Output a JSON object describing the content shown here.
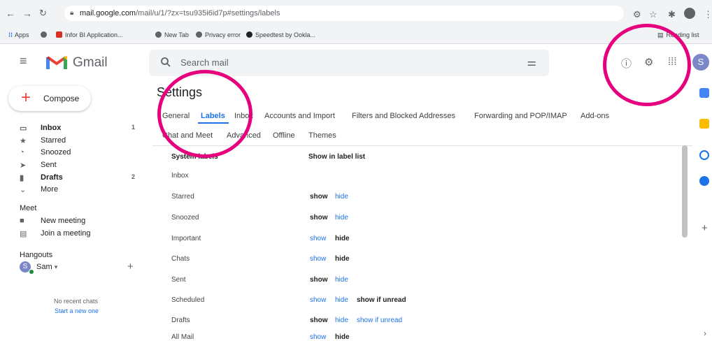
{
  "browser": {
    "url_host": "mail.google.com",
    "url_path": "/mail/u/1/?zx=tsu935i6id7p#settings/labels",
    "bookmarks": [
      "Apps",
      "Infor BI Application...",
      "New Tab",
      "Privacy error",
      "Speedtest by Ookla..."
    ],
    "reading_list": "Reading list"
  },
  "header": {
    "app_name": "Gmail",
    "search_placeholder": "Search mail",
    "avatar_letter": "S"
  },
  "sidebar": {
    "compose": "Compose",
    "items": [
      {
        "label": "Inbox",
        "count": "1",
        "icon": "inbox-icon"
      },
      {
        "label": "Starred",
        "count": "",
        "icon": "star-icon"
      },
      {
        "label": "Snoozed",
        "count": "",
        "icon": "clock-icon"
      },
      {
        "label": "Sent",
        "count": "",
        "icon": "send-icon"
      },
      {
        "label": "Drafts",
        "count": "2",
        "icon": "draft-icon"
      },
      {
        "label": "More",
        "count": "",
        "icon": "chevron-down-icon"
      }
    ],
    "meet_title": "Meet",
    "meet_items": [
      "New meeting",
      "Join a meeting"
    ],
    "hangouts_title": "Hangouts",
    "hangouts_user": "Sam",
    "hangouts_user_letter": "S",
    "no_recent": "No recent chats",
    "start_new": "Start a new one"
  },
  "settings": {
    "title": "Settings",
    "tabs_row1": [
      "General",
      "Labels",
      "Inbox",
      "Accounts and Import",
      "Filters and Blocked Addresses",
      "Forwarding and POP/IMAP",
      "Add-ons"
    ],
    "tabs_row2": [
      "Chat and Meet",
      "Advanced",
      "Offline",
      "Themes"
    ],
    "col_system": "System labels",
    "col_show": "Show in label list",
    "labels": [
      {
        "name": "Inbox",
        "opts": []
      },
      {
        "name": "Starred",
        "opts": [
          "show",
          "hide"
        ],
        "selected": "show"
      },
      {
        "name": "Snoozed",
        "opts": [
          "show",
          "hide"
        ],
        "selected": "show"
      },
      {
        "name": "Important",
        "opts": [
          "show",
          "hide"
        ],
        "selected": "hide"
      },
      {
        "name": "Chats",
        "opts": [
          "show",
          "hide"
        ],
        "selected": "hide"
      },
      {
        "name": "Sent",
        "opts": [
          "show",
          "hide"
        ],
        "selected": "show"
      },
      {
        "name": "Scheduled",
        "opts": [
          "show",
          "hide",
          "show if unread"
        ],
        "selected": "show if unread"
      },
      {
        "name": "Drafts",
        "opts": [
          "show",
          "hide",
          "show if unread"
        ],
        "selected": "show"
      },
      {
        "name": "All Mail",
        "opts": [
          "show",
          "hide"
        ],
        "selected": "hide"
      }
    ]
  },
  "colors": {
    "accent": "#1a73e8",
    "highlight_ring": "#e6007e"
  }
}
